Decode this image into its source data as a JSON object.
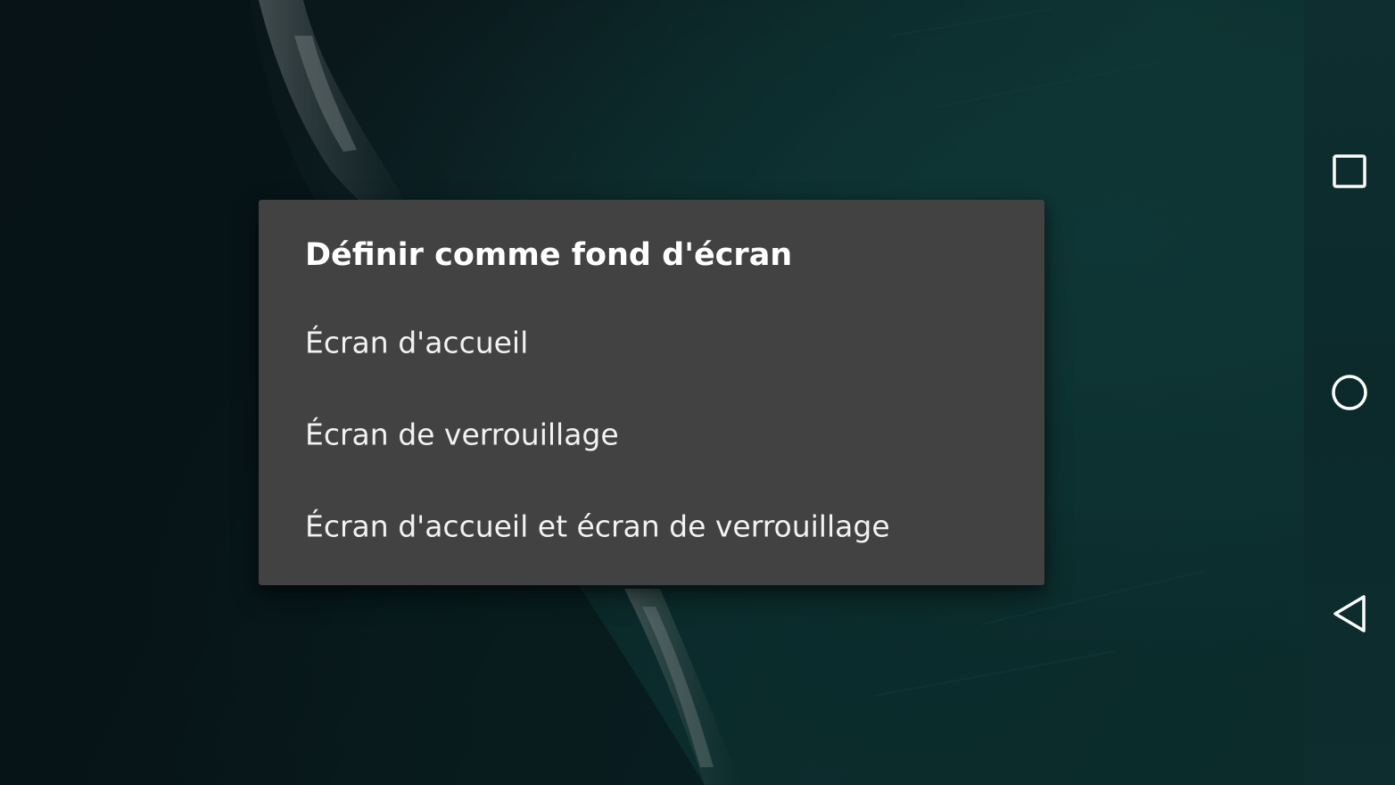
{
  "dialog": {
    "title": "Définir comme fond d'écran",
    "options": [
      {
        "label": "Écran d'accueil"
      },
      {
        "label": "Écran de verrouillage"
      },
      {
        "label": "Écran d'accueil et écran de verrouillage"
      }
    ]
  },
  "navigation_bar": {
    "buttons": [
      {
        "icon": "recents-square-icon"
      },
      {
        "icon": "home-circle-icon"
      },
      {
        "icon": "back-triangle-icon"
      }
    ]
  },
  "colors": {
    "dialog_background": "#424242",
    "dialog_text": "#ffffff",
    "wallpaper_teal": "#124443",
    "navbar_background": "#0d2d2e"
  }
}
